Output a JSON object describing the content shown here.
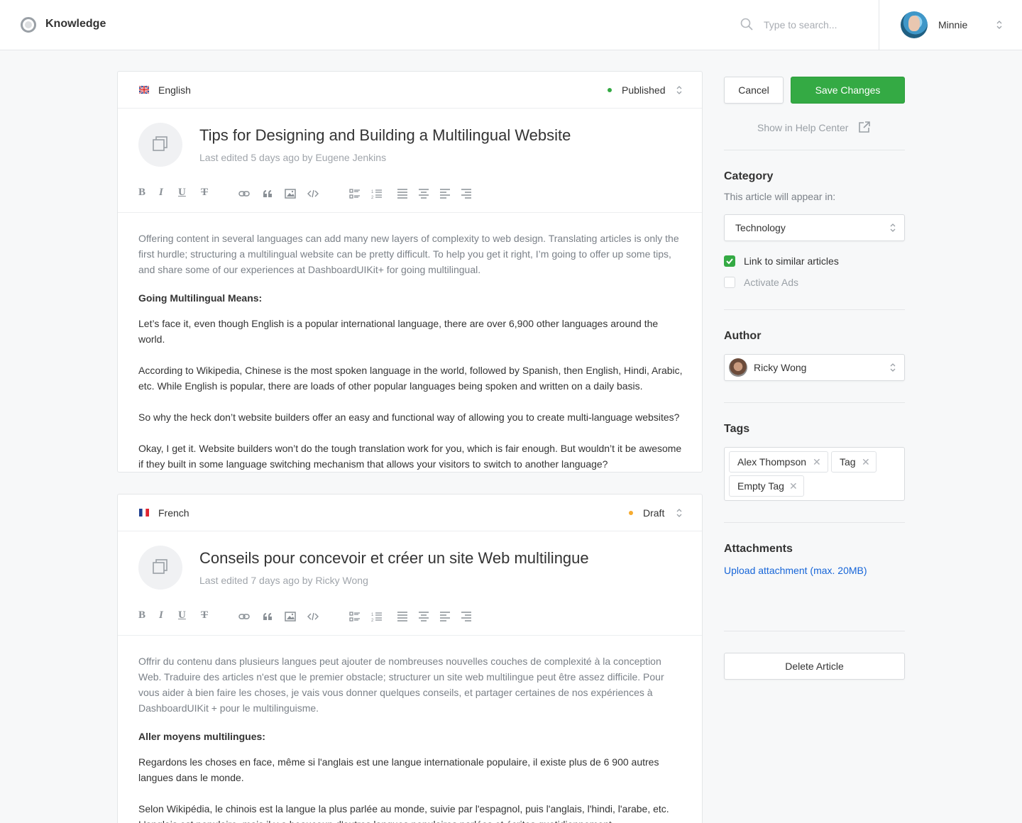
{
  "app": {
    "brand": "Knowledge",
    "logo_icon": "lifebuoy-icon"
  },
  "search": {
    "placeholder": "Type to search..."
  },
  "user": {
    "name": "Minnie"
  },
  "articles": [
    {
      "language": "English",
      "flag": "uk-flag-icon",
      "status": "Published",
      "status_color": "#34aa44",
      "title": "Tips for Designing and Building a Multilingual Website",
      "meta": "Last edited 5 days ago by Eugene Jenkins",
      "intro": "Offering content in several languages can add many new layers of complexity to web design. Translating articles is only the first hurdle; structuring a multilingual website can be pretty difficult. To help you get it right, I’m going to offer up some tips, and share some of our experiences at DashboardUIKit+ for going multilingual.",
      "heading": "Going Multilingual Means:",
      "paragraphs": [
        "Let’s face it, even though English is a popular international language, there are over 6,900 other languages around the world.",
        "According to Wikipedia, Chinese is the most spoken language in the world, followed by Spanish, then English, Hindi, Arabic, etc. While English is popular, there are loads of other popular languages being spoken and written on a daily basis.",
        "So why the heck don’t website builders offer an easy and functional way of allowing you to create multi-language websites?",
        "Okay, I get it. Website builders won’t do the tough translation work for you, which is fair enough. But wouldn’t it be awesome if they built in some language switching mechanism that allows your visitors to switch to another language?"
      ]
    },
    {
      "language": "French",
      "flag": "france-flag-icon",
      "status": "Draft",
      "status_color": "#f6ab2f",
      "title": "Conseils pour concevoir et créer un site Web multilingue",
      "meta": "Last edited 7 days ago by Ricky Wong",
      "intro": "Offrir du contenu dans plusieurs langues peut ajouter de nombreuses nouvelles couches de complexité à la conception Web. Traduire des articles n'est que le premier obstacle; structurer un site web multilingue peut être assez difficile. Pour vous aider à bien faire les choses, je vais vous donner quelques conseils, et partager certaines de nos expériences à DashboardUIKit + pour le multilinguisme.",
      "heading": "Aller moyens multilingues:",
      "paragraphs": [
        "Regardons les choses en face, même si l'anglais est une langue internationale populaire, il existe plus de 6 900 autres langues dans le monde.",
        "Selon Wikipédia, le chinois est la langue la plus parlée au monde, suivie par l'espagnol, puis l'anglais, l'hindi, l'arabe, etc. L'anglais est populaire, mais il y a beaucoup d'autres langues populaires parlées et écrites quotidiennement."
      ]
    }
  ],
  "toolbar": {
    "bold": "B",
    "italic": "I",
    "underline": "U",
    "strike": "T",
    "icons": [
      "link-icon",
      "quote-icon",
      "image-icon",
      "code-icon",
      "bulleted-list-icon",
      "numbered-list-icon",
      "align-justify-icon",
      "align-center-icon",
      "align-left-icon",
      "align-right-icon"
    ]
  },
  "actions": {
    "cancel": "Cancel",
    "save": "Save Changes",
    "help_center": "Show in Help Center",
    "delete": "Delete Article"
  },
  "category": {
    "title": "Category",
    "subtitle": "This article will appear in:",
    "value": "Technology",
    "options": [
      {
        "label": "Link to similar articles",
        "checked": true
      },
      {
        "label": "Activate Ads",
        "checked": false
      }
    ]
  },
  "author": {
    "title": "Author",
    "value": "Ricky Wong"
  },
  "tags": {
    "title": "Tags",
    "items": [
      "Alex Thompson",
      "Tag",
      "Empty Tag"
    ]
  },
  "attachments": {
    "title": "Attachments",
    "upload_label": "Upload attachment (max. 20MB)"
  },
  "colors": {
    "accent": "#34aa44",
    "link": "#1665d8",
    "draft": "#f6ab2f"
  }
}
